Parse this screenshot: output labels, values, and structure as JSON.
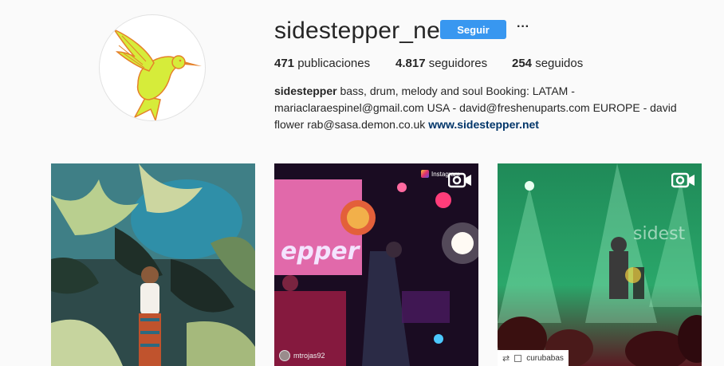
{
  "profile": {
    "username": "sidestepper_net",
    "follow_label": "Seguir",
    "more_label": "···",
    "avatar_icon": "hummingbird-logo"
  },
  "stats": {
    "posts_count": "471",
    "posts_label": " publicaciones",
    "followers_count": "4.817",
    "followers_label": " seguidores",
    "following_count": "254",
    "following_label": " seguidos"
  },
  "bio": {
    "name": "sidestepper",
    "text": " bass, drum, melody and soul Booking: LATAM - mariaclaraespinel@gmail.com USA - david@freshenuparts.com EUROPE - david flower rab@sasa.demon.co.uk ",
    "link": "www.sidestepper.net"
  },
  "posts": [
    {
      "type": "image"
    },
    {
      "type": "video",
      "overlay_user": "mtrojas92",
      "tag": "Instagram"
    },
    {
      "type": "video",
      "repost_user": "curubabas"
    }
  ],
  "colors": {
    "follow_button": "#3897f0",
    "link": "#003569",
    "background": "#fafafa"
  }
}
